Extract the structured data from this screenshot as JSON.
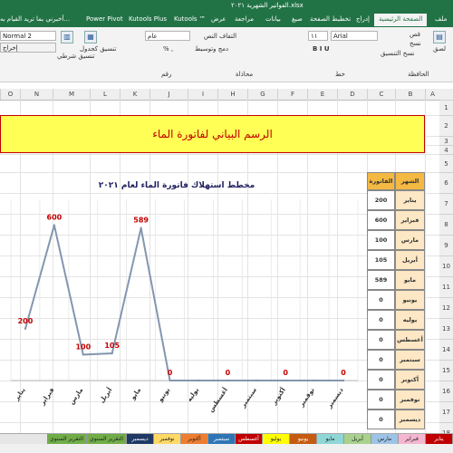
{
  "window": {
    "file_title": "الفواتير الشهرية ٢٠٢١.xlsx",
    "tell_me": "أخبرني بما تريد القيام به..."
  },
  "ribbon_tabs": [
    "ملف",
    "الصفحة الرئيسية",
    "إدراج",
    "تخطيط الصفحة",
    "صيغ",
    "بيانات",
    "مراجعة",
    "عرض",
    "Kutools ™",
    "Kutools Plus",
    "Power Pivot"
  ],
  "ribbon": {
    "font_name": "Arial",
    "font_size": "١١",
    "cell_style": "Normal 2",
    "output_style": "إخراج",
    "alignment_label": "محاذاة",
    "wrap_text": "التفاف النص",
    "merge_center": "دمج وتوسيط",
    "number_format": "عام",
    "number_label": "رقم",
    "clipboard_label": "الحافظة",
    "font_label": "خط",
    "conditional_format": "تنسيق شرطي",
    "format_as_table": "تنسيق كجدول",
    "paste": "لصق",
    "cut": "قص",
    "copy": "نسخ",
    "format_painter": "نسخ التنسيق"
  },
  "columns": [
    "A",
    "B",
    "C",
    "D",
    "E",
    "F",
    "G",
    "H",
    "I",
    "J",
    "K",
    "L",
    "M",
    "N",
    "O"
  ],
  "rows": [
    "1",
    "2",
    "3",
    "4",
    "5",
    "6",
    "7",
    "8",
    "9",
    "10",
    "11",
    "12",
    "13",
    "14",
    "15",
    "16",
    "17",
    "18"
  ],
  "banner_title": "الرسم البياني لفاتورة الماء",
  "table": {
    "header_month": "الشهر",
    "header_bill": "الفاتورة",
    "rows": [
      {
        "month": "يناير",
        "bill": "200"
      },
      {
        "month": "فبراير",
        "bill": "600"
      },
      {
        "month": "مارس",
        "bill": "100"
      },
      {
        "month": "أبريل",
        "bill": "105"
      },
      {
        "month": "مايو",
        "bill": "589"
      },
      {
        "month": "يونيو",
        "bill": "0"
      },
      {
        "month": "يوليه",
        "bill": "0"
      },
      {
        "month": "أغسطس",
        "bill": "0"
      },
      {
        "month": "سبتمبر",
        "bill": "0"
      },
      {
        "month": "أكتوبر",
        "bill": "0"
      },
      {
        "month": "نوفمبر",
        "bill": "0"
      },
      {
        "month": "ديسمبر",
        "bill": "0"
      }
    ]
  },
  "chart_data": {
    "type": "line",
    "title": "مخطط استهلاك فاتورة الماء لعام ٢٠٢١",
    "categories": [
      "يناير",
      "فبراير",
      "مارس",
      "أبريل",
      "مايو",
      "يونيو",
      "يوليه",
      "أغسطس",
      "سبتمبر",
      "أكتوبر",
      "نوفمبر",
      "ديسمبر"
    ],
    "values": [
      200,
      600,
      100,
      105,
      589,
      0,
      0,
      0,
      0,
      0,
      0,
      0
    ],
    "data_labels": [
      "200",
      "600",
      "100",
      "105",
      "589",
      "0",
      "",
      "0",
      "",
      "0",
      "",
      "0"
    ],
    "ylim": [
      0,
      700
    ],
    "grid": true,
    "line_color": "#8496b0",
    "label_color": "#c00000"
  },
  "sheet_tabs": [
    {
      "label": "يناير",
      "color": "#c00000"
    },
    {
      "label": "فبراير",
      "color": "#f4b6d0"
    },
    {
      "label": "مارس",
      "color": "#9dc3e6"
    },
    {
      "label": "أبريل",
      "color": "#a9d18e"
    },
    {
      "label": "مايو",
      "color": "#8fd6d6"
    },
    {
      "label": "يونيو",
      "color": "#c55a11"
    },
    {
      "label": "يوليو",
      "color": "#ffff00"
    },
    {
      "label": "أغسطس",
      "color": "#c00000"
    },
    {
      "label": "سبتمبر",
      "color": "#2e75b6"
    },
    {
      "label": "أكتوبر",
      "color": "#ed7d31"
    },
    {
      "label": "نوفمبر",
      "color": "#ffd966"
    },
    {
      "label": "ديسمبر",
      "color": "#1f3864"
    },
    {
      "label": "التقرير السنوي",
      "color": "#70ad47"
    },
    {
      "label": "التقرير السنوي",
      "color": "#70ad47"
    }
  ]
}
